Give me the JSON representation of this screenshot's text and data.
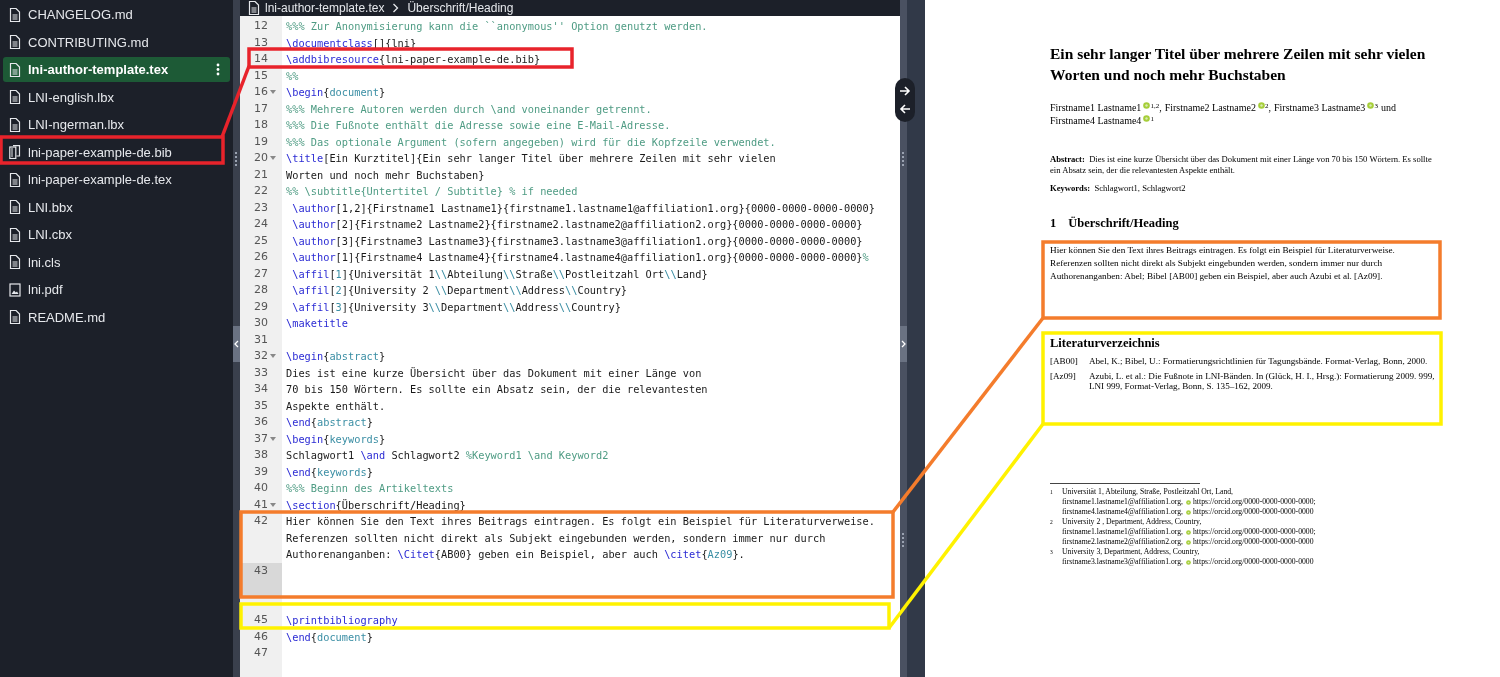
{
  "files": [
    {
      "label": "CHANGELOG.md",
      "kind": "doc",
      "selected": false
    },
    {
      "label": "CONTRIBUTING.md",
      "kind": "doc",
      "selected": false
    },
    {
      "label": "lni-author-template.tex",
      "kind": "doc",
      "selected": true
    },
    {
      "label": "LNI-english.lbx",
      "kind": "doc",
      "selected": false
    },
    {
      "label": "LNI-ngerman.lbx",
      "kind": "doc",
      "selected": false
    },
    {
      "label": "lni-paper-example-de.bib",
      "kind": "bib",
      "selected": false
    },
    {
      "label": "lni-paper-example-de.tex",
      "kind": "doc",
      "selected": false
    },
    {
      "label": "LNI.bbx",
      "kind": "doc",
      "selected": false
    },
    {
      "label": "LNI.cbx",
      "kind": "doc",
      "selected": false
    },
    {
      "label": "lni.cls",
      "kind": "doc",
      "selected": false
    },
    {
      "label": "lni.pdf",
      "kind": "image",
      "selected": false
    },
    {
      "label": "README.md",
      "kind": "doc",
      "selected": false
    }
  ],
  "breadcrumb": [
    "lni-author-template.tex",
    "Überschrift/Heading"
  ],
  "code_lines": [
    {
      "n": "12",
      "fold": false,
      "active": false,
      "tokens": [
        {
          "kind": "comment",
          "text": "%%% Zur Anonymisierung kann die ``anonymous'' Option genutzt werden."
        }
      ]
    },
    {
      "n": "13",
      "fold": false,
      "active": false,
      "tokens": [
        {
          "kind": "command",
          "text": "\\documentclass"
        },
        {
          "kind": "text",
          "text": "[]{lni}"
        }
      ]
    },
    {
      "n": "14",
      "fold": false,
      "active": false,
      "tokens": [
        {
          "kind": "command",
          "text": "\\addbibresource"
        },
        {
          "kind": "text",
          "text": "{lni-paper-example-de.bib}"
        }
      ]
    },
    {
      "n": "15",
      "fold": false,
      "active": false,
      "tokens": [
        {
          "kind": "comment",
          "text": "%%"
        }
      ]
    },
    {
      "n": "16",
      "fold": true,
      "active": false,
      "tokens": [
        {
          "kind": "command",
          "text": "\\begin"
        },
        {
          "kind": "text",
          "text": "{"
        },
        {
          "kind": "arg",
          "text": "document"
        },
        {
          "kind": "text",
          "text": "}"
        }
      ]
    },
    {
      "n": "17",
      "fold": false,
      "active": false,
      "tokens": [
        {
          "kind": "comment",
          "text": "%%% Mehrere Autoren werden durch \\and voneinander getrennt."
        }
      ]
    },
    {
      "n": "18",
      "fold": false,
      "active": false,
      "tokens": [
        {
          "kind": "comment",
          "text": "%%% Die Fußnote enthält die Adresse sowie eine E-Mail-Adresse."
        }
      ]
    },
    {
      "n": "19",
      "fold": false,
      "active": false,
      "tokens": [
        {
          "kind": "comment",
          "text": "%%% Das optionale Argument (sofern angegeben) wird für die Kopfzeile verwendet."
        }
      ]
    },
    {
      "n": "20",
      "fold": true,
      "active": false,
      "tokens": [
        {
          "kind": "command",
          "text": "\\title"
        },
        {
          "kind": "text",
          "text": "[Ein Kurztitel]{Ein sehr langer Titel über mehrere Zeilen mit sehr vielen"
        }
      ]
    },
    {
      "n": "21",
      "fold": false,
      "active": false,
      "tokens": [
        {
          "kind": "text",
          "text": "Worten und noch mehr Buchstaben}"
        }
      ]
    },
    {
      "n": "22",
      "fold": false,
      "active": false,
      "tokens": [
        {
          "kind": "comment",
          "text": "%% \\subtitle{Untertitel / Subtitle} % if needed"
        }
      ]
    },
    {
      "n": "23",
      "fold": false,
      "active": false,
      "tokens": [
        {
          "kind": "command",
          "text": " \\author"
        },
        {
          "kind": "text",
          "text": "[1,2]{Firstname1 Lastname1}{firstname1.lastname1@affiliation1.org}{0000-0000-0000-0000}"
        }
      ]
    },
    {
      "n": "24",
      "fold": false,
      "active": false,
      "tokens": [
        {
          "kind": "command",
          "text": " \\author"
        },
        {
          "kind": "text",
          "text": "[2]{Firstname2 Lastname2}{firstname2.lastname2@affiliation2.org}{0000-0000-0000-0000}"
        }
      ]
    },
    {
      "n": "25",
      "fold": false,
      "active": false,
      "tokens": [
        {
          "kind": "command",
          "text": " \\author"
        },
        {
          "kind": "text",
          "text": "[3]{Firstname3 Lastname3}{firstname3.lastname3@affiliation1.org}{0000-0000-0000-0000}"
        }
      ]
    },
    {
      "n": "26",
      "fold": false,
      "active": false,
      "tokens": [
        {
          "kind": "command",
          "text": " \\author"
        },
        {
          "kind": "text",
          "text": "[1]{Firstname4 Lastname4}{firstname4.lastname4@affiliation1.org}{0000-0000-0000-0000}"
        },
        {
          "kind": "comment",
          "text": "%"
        }
      ]
    },
    {
      "n": "27",
      "fold": false,
      "active": false,
      "tokens": [
        {
          "kind": "command",
          "text": " \\affil"
        },
        {
          "kind": "text",
          "text": "["
        },
        {
          "kind": "arg",
          "text": "1"
        },
        {
          "kind": "text",
          "text": "]{Universität 1"
        },
        {
          "kind": "arg",
          "text": "\\\\"
        },
        {
          "kind": "text",
          "text": "Abteilung"
        },
        {
          "kind": "arg",
          "text": "\\\\"
        },
        {
          "kind": "text",
          "text": "Straße"
        },
        {
          "kind": "arg",
          "text": "\\\\"
        },
        {
          "kind": "text",
          "text": "Postleitzahl Ort"
        },
        {
          "kind": "arg",
          "text": "\\\\"
        },
        {
          "kind": "text",
          "text": "Land}"
        }
      ]
    },
    {
      "n": "28",
      "fold": false,
      "active": false,
      "tokens": [
        {
          "kind": "command",
          "text": " \\affil"
        },
        {
          "kind": "text",
          "text": "["
        },
        {
          "kind": "arg",
          "text": "2"
        },
        {
          "kind": "text",
          "text": "]{University 2 "
        },
        {
          "kind": "arg",
          "text": "\\\\"
        },
        {
          "kind": "text",
          "text": "Department"
        },
        {
          "kind": "arg",
          "text": "\\\\"
        },
        {
          "kind": "text",
          "text": "Address"
        },
        {
          "kind": "arg",
          "text": "\\\\"
        },
        {
          "kind": "text",
          "text": "Country}"
        }
      ]
    },
    {
      "n": "29",
      "fold": false,
      "active": false,
      "tokens": [
        {
          "kind": "command",
          "text": " \\affil"
        },
        {
          "kind": "text",
          "text": "["
        },
        {
          "kind": "arg",
          "text": "3"
        },
        {
          "kind": "text",
          "text": "]{University 3"
        },
        {
          "kind": "arg",
          "text": "\\\\"
        },
        {
          "kind": "text",
          "text": "Department"
        },
        {
          "kind": "arg",
          "text": "\\\\"
        },
        {
          "kind": "text",
          "text": "Address"
        },
        {
          "kind": "arg",
          "text": "\\\\"
        },
        {
          "kind": "text",
          "text": "Country}"
        }
      ]
    },
    {
      "n": "30",
      "fold": false,
      "active": false,
      "tokens": [
        {
          "kind": "command",
          "text": "\\maketitle"
        }
      ]
    },
    {
      "n": "31",
      "fold": false,
      "active": false
    },
    {
      "n": "32",
      "fold": true,
      "active": false,
      "tokens": [
        {
          "kind": "command",
          "text": "\\begin"
        },
        {
          "kind": "text",
          "text": "{"
        },
        {
          "kind": "arg",
          "text": "abstract"
        },
        {
          "kind": "text",
          "text": "}"
        }
      ]
    },
    {
      "n": "33",
      "fold": false,
      "active": false,
      "tokens": [
        {
          "kind": "text",
          "text": "Dies ist eine kurze Übersicht über das Dokument mit einer Länge von"
        }
      ]
    },
    {
      "n": "34",
      "fold": false,
      "active": false,
      "tokens": [
        {
          "kind": "text",
          "text": "70 bis 150 Wörtern. Es sollte ein Absatz sein, der die relevantesten"
        }
      ]
    },
    {
      "n": "35",
      "fold": false,
      "active": false,
      "tokens": [
        {
          "kind": "text",
          "text": "Aspekte enthält."
        }
      ]
    },
    {
      "n": "36",
      "fold": false,
      "active": false,
      "tokens": [
        {
          "kind": "command",
          "text": "\\end"
        },
        {
          "kind": "text",
          "text": "{"
        },
        {
          "kind": "arg",
          "text": "abstract"
        },
        {
          "kind": "text",
          "text": "}"
        }
      ]
    },
    {
      "n": "37",
      "fold": true,
      "active": false,
      "tokens": [
        {
          "kind": "command",
          "text": "\\begin"
        },
        {
          "kind": "text",
          "text": "{"
        },
        {
          "kind": "arg",
          "text": "keywords"
        },
        {
          "kind": "text",
          "text": "}"
        }
      ]
    },
    {
      "n": "38",
      "fold": false,
      "active": false,
      "tokens": [
        {
          "kind": "text",
          "text": "Schlagwort1 "
        },
        {
          "kind": "command",
          "text": "\\and"
        },
        {
          "kind": "text",
          "text": " Schlagwort2 "
        },
        {
          "kind": "comment",
          "text": "%Keyword1 \\and Keyword2"
        }
      ]
    },
    {
      "n": "39",
      "fold": false,
      "active": false,
      "tokens": [
        {
          "kind": "command",
          "text": "\\end"
        },
        {
          "kind": "text",
          "text": "{"
        },
        {
          "kind": "arg",
          "text": "keywords"
        },
        {
          "kind": "text",
          "text": "}"
        }
      ]
    },
    {
      "n": "40",
      "fold": false,
      "active": false,
      "tokens": [
        {
          "kind": "comment",
          "text": "%%% Beginn des Artikeltexts"
        }
      ]
    },
    {
      "n": "41",
      "fold": true,
      "active": false,
      "tokens": [
        {
          "kind": "command",
          "text": "\\section"
        },
        {
          "kind": "text",
          "text": "{Überschrift/Heading}"
        }
      ]
    },
    {
      "n": "42",
      "fold": false,
      "active": false,
      "tokens": [
        {
          "kind": "text",
          "text": "Hier können Sie den Text ihres Beitrags eintragen. Es folgt ein Beispiel für Literaturverweise. Referenzen sollten nicht direkt als Subjekt eingebunden werden, sondern immer nur durch Authorenanganben: "
        },
        {
          "kind": "command",
          "text": "\\Citet"
        },
        {
          "kind": "text",
          "text": "{AB00} geben ein Beispiel, aber auch "
        },
        {
          "kind": "command",
          "text": "\\citet"
        },
        {
          "kind": "text",
          "text": "{"
        },
        {
          "kind": "arg",
          "text": "Az09"
        },
        {
          "kind": "text",
          "text": "}."
        }
      ]
    },
    {
      "n": "43",
      "fold": false,
      "active": true
    },
    {
      "fold": false,
      "active": false
    },
    {
      "n": "45",
      "fold": false,
      "active": false,
      "tokens": [
        {
          "kind": "command",
          "text": "\\printbibliography"
        }
      ]
    },
    {
      "n": "46",
      "fold": false,
      "active": false,
      "tokens": [
        {
          "kind": "command",
          "text": "\\end"
        },
        {
          "kind": "text",
          "text": "{"
        },
        {
          "kind": "arg",
          "text": "document"
        },
        {
          "kind": "text",
          "text": "}"
        }
      ]
    },
    {
      "n": "47",
      "fold": false,
      "active": false
    }
  ],
  "pdf": {
    "title": "Ein sehr langer Titel über mehrere Zeilen mit sehr vielen Worten und noch mehr Buchstaben",
    "authors": [
      {
        "name": "Firstname1 Lastname1",
        "sup": "1,2",
        "after": ","
      },
      {
        "name": "Firstname2 Lastname2",
        "sup": "2",
        "after": ","
      },
      {
        "name": "Firstname3 Lastname3",
        "sup": "3",
        "after": "und"
      },
      {
        "name": "Firstname4 Lastname4",
        "sup": "1"
      }
    ],
    "abstract": "**Abstract:**  Dies ist eine kurze Übersicht über das Dokument mit einer Länge von 70 bis 150 Wörtern. Es sollte ein Absatz sein, der die relevantesten Aspekte enthält.",
    "keywords": "**Keywords:**  Schlagwort1, Schlagwort2",
    "section_number": "1",
    "section_title": "Überschrift/Heading",
    "paragraph": "Hier können Sie den Text ihres Beitrags eintragen. Es folgt ein Beispiel für Literaturverweise. Referenzen sollten nicht direkt als Subjekt eingebunden werden, sondern immer nur durch Authorenanganben: Abel; Bibel [AB00] geben ein Beispiel, aber auch Azubi et al. [Az09].",
    "bibliography_title": "Literaturverzeichnis",
    "bibliography": [
      {
        "key": "[AB00]",
        "text": "Abel, K.; Bibel, U.: Formatierungsrichtlinien für Tagungsbände. Format-Verlag, Bonn, 2000."
      },
      {
        "key": "[Az09]",
        "text": "Azubi, L. et al.: Die Fußnote in LNI-Bänden. In (Glück, H. I., Hrsg.): Formatierung 2009. 999, LNI 999, Format-Verlag, Bonn, S. 135–162, 2009."
      }
    ],
    "footnotes": [
      {
        "number": "1",
        "address": "Universität 1, Abteilung, Straße, Postleitzahl Ort, Land,",
        "contacts": [
          {
            "email": "firstname1.lastname1@affiliation1.org,",
            "orcid": "https://orcid.org/0000-0000-0000-0000;"
          },
          {
            "email": "firstname4.lastname4@affiliation1.org,",
            "orcid": "https://orcid.org/0000-0000-0000-0000"
          }
        ]
      },
      {
        "number": "2",
        "address": "University 2 , Department, Address, Country,",
        "contacts": [
          {
            "email": "firstname1.lastname1@affiliation1.org,",
            "orcid": "https://orcid.org/0000-0000-0000-0000;"
          },
          {
            "email": "firstname2.lastname2@affiliation2.org,",
            "orcid": "https://orcid.org/0000-0000-0000-0000"
          }
        ]
      },
      {
        "number": "3",
        "address": "University 3, Department, Address, Country,",
        "contacts": [
          {
            "email": "firstname3.lastname3@affiliation1.org,",
            "orcid": "https://orcid.org/0000-0000-0000-0000"
          }
        ]
      }
    ]
  },
  "annotations": [
    {
      "color": "#e8232b"
    },
    {
      "color": "#f47c2c"
    },
    {
      "color": "#fff200"
    }
  ]
}
